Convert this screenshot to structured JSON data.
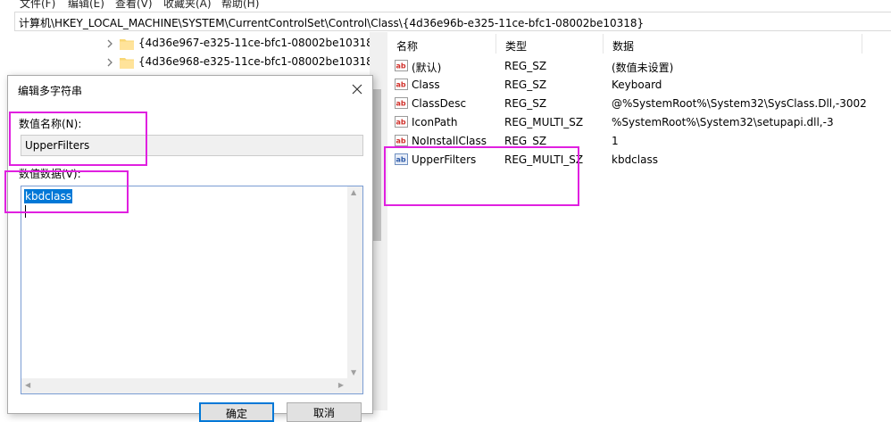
{
  "menu": [
    "文件(F)",
    "编辑(E)",
    "查看(V)",
    "收藏夹(A)",
    "帮助(H)"
  ],
  "address": "计算机\\HKEY_LOCAL_MACHINE\\SYSTEM\\CurrentControlSet\\Control\\Class\\{4d36e96b-e325-11ce-bfc1-08002be10318}",
  "tree": {
    "items": [
      {
        "label": "{4d36e967-e325-11ce-bfc1-08002be10318}"
      },
      {
        "label": "{4d36e968-e325-11ce-bfc1-08002be10318}"
      }
    ]
  },
  "list": {
    "columns": [
      "名称",
      "类型",
      "数据"
    ],
    "rows": [
      {
        "icon": "string-value-icon",
        "name": "(默认)",
        "type": "REG_SZ",
        "data": "(数值未设置)"
      },
      {
        "icon": "string-value-icon",
        "name": "Class",
        "type": "REG_SZ",
        "data": "Keyboard"
      },
      {
        "icon": "string-value-icon",
        "name": "ClassDesc",
        "type": "REG_SZ",
        "data": "@%SystemRoot%\\System32\\SysClass.Dll,-3002"
      },
      {
        "icon": "string-value-icon",
        "name": "IconPath",
        "type": "REG_MULTI_SZ",
        "data": "%SystemRoot%\\System32\\setupapi.dll,-3"
      },
      {
        "icon": "string-value-icon",
        "name": "NoInstallClass",
        "type": "REG_SZ",
        "data": "1"
      },
      {
        "icon": "multi-string-value-icon",
        "name": "UpperFilters",
        "type": "REG_MULTI_SZ",
        "data": "kbdclass"
      }
    ]
  },
  "dialog": {
    "title": "编辑多字符串",
    "name_label": "数值名称(N):",
    "name_value": "UpperFilters",
    "data_label": "数值数据(V):",
    "data_value": "kbdclass",
    "ok": "确定",
    "cancel": "取消"
  },
  "colors": {
    "highlight": "#0078d7",
    "annotation": "#e020e0",
    "folder": "#f8d775"
  }
}
